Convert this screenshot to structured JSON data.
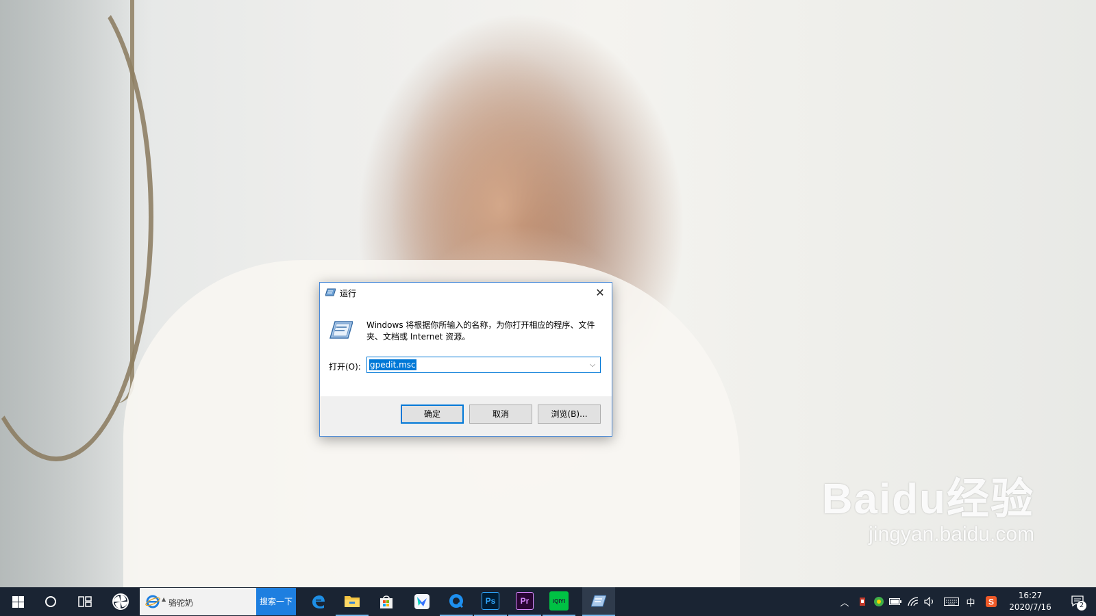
{
  "dialog": {
    "title": "运行",
    "description": "Windows 将根据你所输入的名称，为你打开相应的程序、文件夹、文档或 Internet 资源。",
    "open_label": "打开(O):",
    "input_value": "gpedit.msc",
    "ok_label": "确定",
    "cancel_label": "取消",
    "browse_label": "浏览(B)...",
    "close_icon": "close-icon"
  },
  "taskbar": {
    "search_value": "骆驼奶",
    "search_button": "搜索一下",
    "apps": [
      {
        "name": "start-icon"
      },
      {
        "name": "cortana-icon"
      },
      {
        "name": "task-view-icon"
      },
      {
        "name": "pinwheel-app-icon"
      },
      {
        "name": "edge-icon"
      },
      {
        "name": "file-explorer-icon"
      },
      {
        "name": "store-icon"
      },
      {
        "name": "feishu-icon"
      },
      {
        "name": "qq-browser-icon"
      },
      {
        "name": "photoshop-icon",
        "label": "Ps"
      },
      {
        "name": "premiere-icon",
        "label": "Pr"
      },
      {
        "name": "iqiyi-icon",
        "label": "iQIYI"
      },
      {
        "name": "run-icon"
      }
    ],
    "tray": {
      "ime_label": "中",
      "time": "16:27",
      "date": "2020/7/16",
      "notification_count": "2"
    }
  },
  "watermark": {
    "logo": "Baidu经验",
    "url": "jingyan.baidu.com"
  },
  "colors": {
    "taskbar": "#1a2433",
    "accent": "#0078d7",
    "search_button": "#1e7fe0"
  }
}
